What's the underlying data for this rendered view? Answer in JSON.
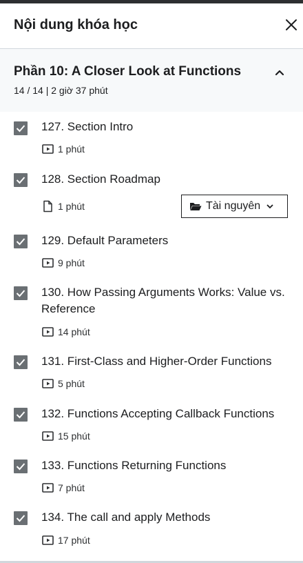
{
  "panel": {
    "title": "Nội dung khóa học"
  },
  "section": {
    "title": "Phần 10: A Closer Look at Functions",
    "meta": "14 / 14 | 2 giờ 37 phút"
  },
  "lectures": [
    {
      "title": "127. Section Intro",
      "duration": "1 phút",
      "type": "video",
      "completed": true
    },
    {
      "title": "128. Section Roadmap",
      "duration": "1 phút",
      "type": "file",
      "completed": true,
      "resources_label": "Tài nguyên"
    },
    {
      "title": "129. Default Parameters",
      "duration": "9 phút",
      "type": "video",
      "completed": true
    },
    {
      "title": "130. How Passing Arguments Works: Value vs. Reference",
      "duration": "14 phút",
      "type": "video",
      "completed": true
    },
    {
      "title": "131. First-Class and Higher-Order Functions",
      "duration": "5 phút",
      "type": "video",
      "completed": true
    },
    {
      "title": "132. Functions Accepting Callback Functions",
      "duration": "15 phút",
      "type": "video",
      "completed": true
    },
    {
      "title": "133. Functions Returning Functions",
      "duration": "7 phút",
      "type": "video",
      "completed": true
    },
    {
      "title": "134. The call and apply Methods",
      "duration": "17 phút",
      "type": "video",
      "completed": true
    }
  ]
}
